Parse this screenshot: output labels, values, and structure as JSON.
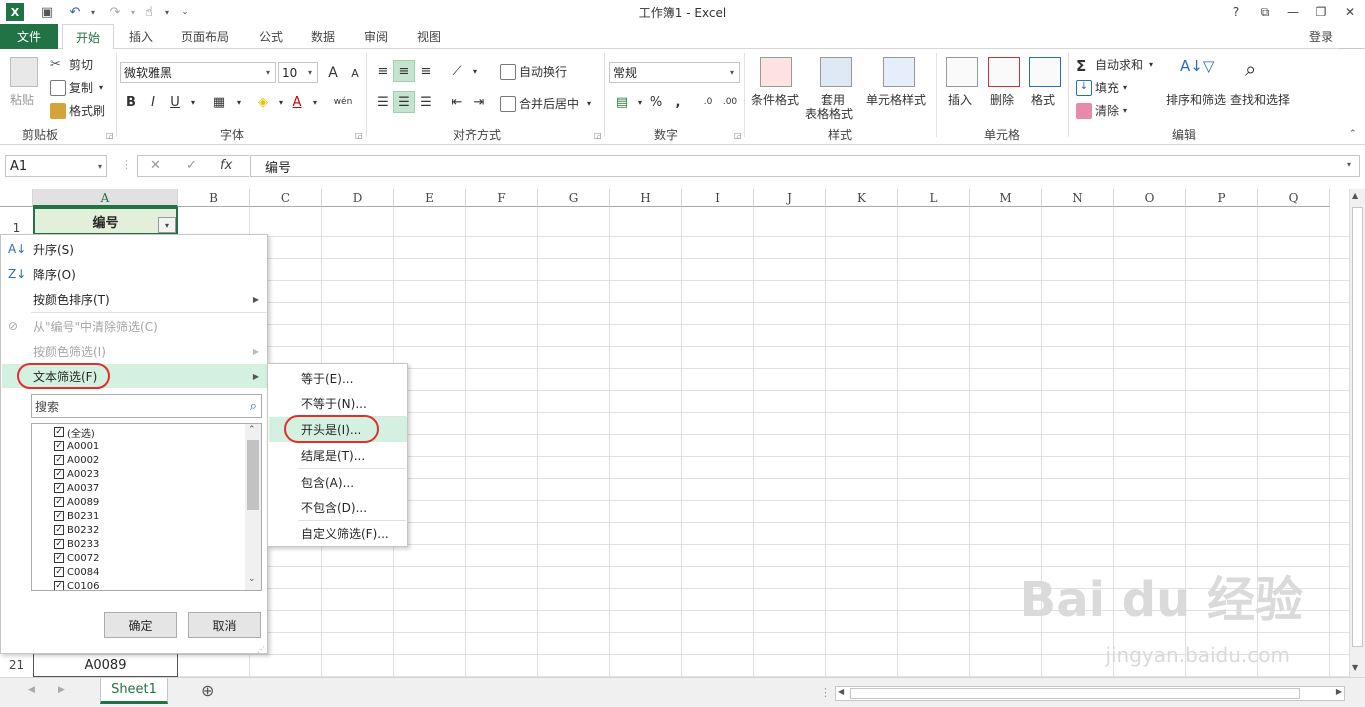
{
  "window": {
    "title": "工作簿1 - Excel",
    "help": "?",
    "ribbon_toggle": "⧉",
    "minimize": "—",
    "restore": "❐",
    "close": "✕"
  },
  "tabs": [
    "文件",
    "开始",
    "插入",
    "页面布局",
    "公式",
    "数据",
    "审阅",
    "视图"
  ],
  "account": {
    "login": "登录"
  },
  "ribbon": {
    "clipboard": {
      "label": "剪贴板",
      "paste": "粘贴",
      "cut": "剪切",
      "copy": "复制",
      "format_painter": "格式刷"
    },
    "font": {
      "label": "字体",
      "name": "微软雅黑",
      "size": "10",
      "grow": "A",
      "shrink": "A",
      "bold": "B",
      "italic": "I",
      "underline": "U",
      "font_color": "A",
      "phonetic": "wén"
    },
    "alignment": {
      "label": "对齐方式",
      "wrap": "自动换行",
      "merge": "合并后居中"
    },
    "number": {
      "label": "数字",
      "format": "常规",
      "percent": "%",
      "comma": ","
    },
    "styles": {
      "label": "样式",
      "conditional": "条件格式",
      "table_1": "套用",
      "table_2": "表格格式",
      "cell_styles": "单元格样式"
    },
    "cells": {
      "label": "单元格",
      "insert": "插入",
      "delete": "删除",
      "format": "格式"
    },
    "editing": {
      "label": "编辑",
      "autosum": "自动求和",
      "fill": "填充",
      "clear": "清除",
      "sort_filter": "排序和筛选",
      "find_select": "查找和选择"
    }
  },
  "formula_bar": {
    "name_box": "A1",
    "cancel": "✕",
    "enter": "✓",
    "fx": "fx",
    "content": "编号"
  },
  "grid": {
    "columns": [
      "A",
      "B",
      "C",
      "D",
      "E",
      "F",
      "G",
      "H",
      "I",
      "J",
      "K",
      "L",
      "M",
      "N",
      "O",
      "P",
      "Q"
    ],
    "a1_value": "编号",
    "row1": "1",
    "row21": "21",
    "a21_value": "A0089"
  },
  "filter_menu": {
    "sort_asc": "升序(S)",
    "sort_desc": "降序(O)",
    "sort_color": "按颜色排序(T)",
    "clear_filter": "从\"编号\"中清除筛选(C)",
    "filter_color": "按颜色筛选(I)",
    "text_filter": "文本筛选(F)",
    "search_placeholder": "搜索",
    "items": [
      "(全选)",
      "A0001",
      "A0002",
      "A0023",
      "A0037",
      "A0089",
      "B0231",
      "B0232",
      "B0233",
      "C0072",
      "C0084",
      "C0106"
    ],
    "ok": "确定",
    "cancel": "取消"
  },
  "text_filter_submenu": {
    "equals": "等于(E)...",
    "not_equals": "不等于(N)...",
    "begins_with": "开头是(I)...",
    "ends_with": "结尾是(T)...",
    "contains": "包含(A)...",
    "not_contains": "不包含(D)...",
    "custom": "自定义筛选(F)..."
  },
  "sheets": {
    "active": "Sheet1",
    "add": "⊕"
  },
  "watermark": {
    "brand": "Bai du 经验",
    "url": "jingyan.baidu.com"
  },
  "colors": {
    "excel_green": "#217346",
    "highlight": "#d3f0e0",
    "annotation_red": "#e22d2d"
  }
}
